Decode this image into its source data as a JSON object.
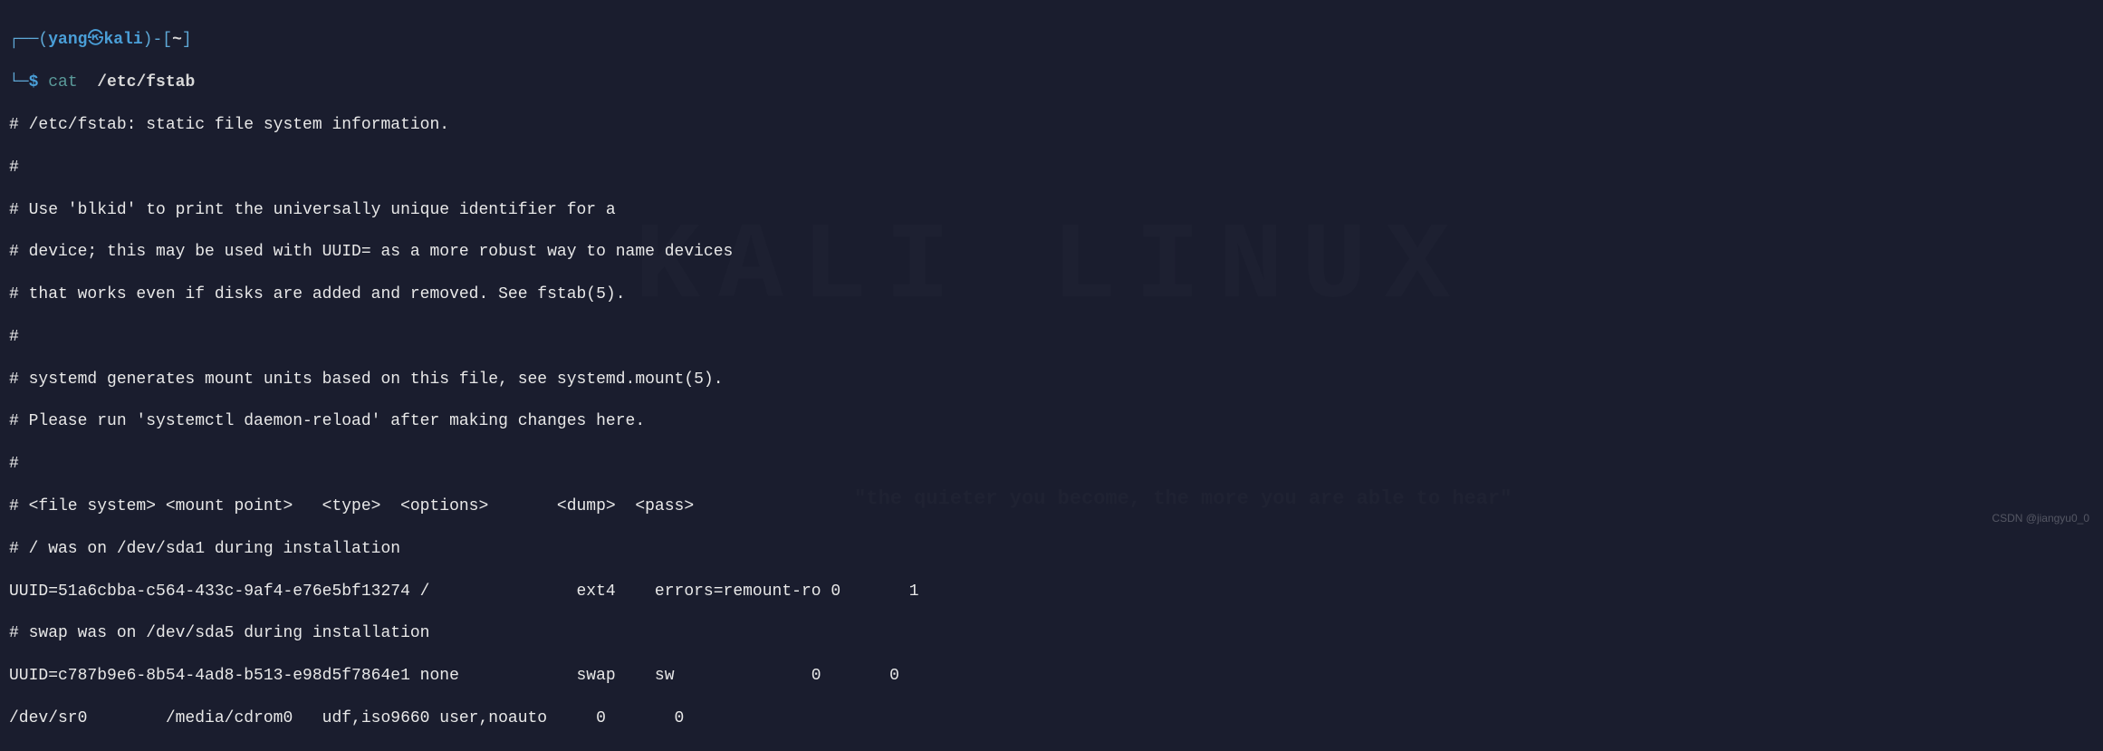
{
  "prompt": {
    "box_left": "┌──(",
    "user": "yang",
    "circle": "㉿",
    "host": "kali",
    "close_paren": ")",
    "dash": "-",
    "path_open": "[",
    "path": "~",
    "path_close": "]",
    "line2_prefix": "└─",
    "dollar": "$",
    "command": "cat",
    "arg": "/etc/fstab"
  },
  "output": {
    "lines": [
      "# /etc/fstab: static file system information.",
      "#",
      "# Use 'blkid' to print the universally unique identifier for a",
      "# device; this may be used with UUID= as a more robust way to name devices",
      "# that works even if disks are added and removed. See fstab(5).",
      "#",
      "# systemd generates mount units based on this file, see systemd.mount(5).",
      "# Please run 'systemctl daemon-reload' after making changes here.",
      "#",
      "# <file system> <mount point>   <type>  <options>       <dump>  <pass>",
      "# / was on /dev/sda1 during installation",
      "UUID=51a6cbba-c564-433c-9af4-e76e5bf13274 /               ext4    errors=remount-ro 0       1",
      "# swap was on /dev/sda5 during installation",
      "UUID=c787b9e6-8b54-4ad8-b513-e98d5f7864e1 none            swap    sw              0       0",
      "/dev/sr0        /media/cdrom0   udf,iso9660 user,noauto     0       0"
    ]
  },
  "watermark": {
    "bg": "KALI LINUX",
    "tagline": "\"the quieter you become, the more you are able to hear\"",
    "csdn": "CSDN @jiangyu0_0"
  }
}
